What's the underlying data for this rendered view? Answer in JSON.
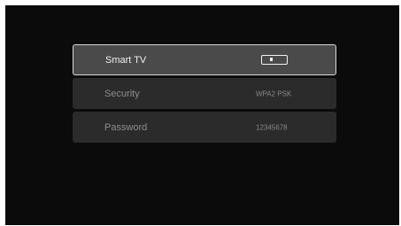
{
  "settings": {
    "rows": [
      {
        "label": "Smart TV",
        "control": "toggle",
        "toggle_on": false,
        "selected": true
      },
      {
        "label": "Security",
        "value": "WPA2 PSK",
        "selected": false
      },
      {
        "label": "Password",
        "value": "12345678",
        "selected": false
      }
    ]
  },
  "colors": {
    "background": "#0b0b0b",
    "row_bg": "#2b2b2b",
    "row_selected_bg": "#4a4a4a",
    "row_selected_border": "#d8d8d8",
    "text_active": "#f0f0f0",
    "text_dim": "#8e8e8e"
  }
}
